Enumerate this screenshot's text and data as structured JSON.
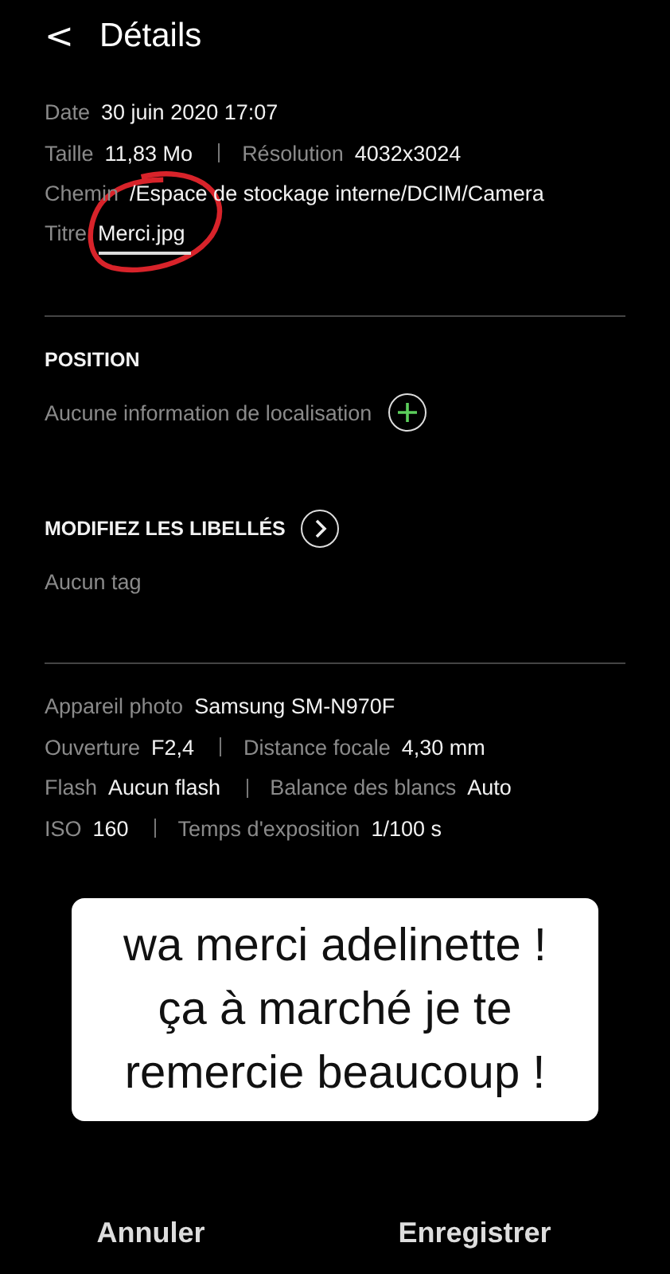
{
  "header": {
    "back": "<",
    "title": "Détails"
  },
  "file_info": [
    [
      {
        "label": "Date",
        "value": "30 juin 2020 17:07"
      }
    ],
    [
      {
        "label": "Taille",
        "value": "11,83 Mo"
      },
      {
        "label": "Résolution",
        "value": "4032x3024"
      }
    ],
    [
      {
        "label": "Chemin",
        "value": "/Espace de stockage interne/DCIM/Camera"
      }
    ]
  ],
  "title_field": {
    "label": "Titre",
    "value": "Merci.jpg"
  },
  "position": {
    "heading": "POSITION",
    "text": "Aucune information de localisation"
  },
  "tags": {
    "heading": "MODIFIEZ LES LIBELLÉS",
    "text": "Aucun tag"
  },
  "camera_info": [
    [
      {
        "label": "Appareil photo",
        "value": "Samsung SM-N970F"
      }
    ],
    [
      {
        "label": "Ouverture",
        "value": "F2,4"
      },
      {
        "label": "Distance focale",
        "value": "4,30 mm"
      }
    ],
    [
      {
        "label": "Flash",
        "value": "Aucun flash"
      },
      {
        "label": "Balance des blancs",
        "value": "Auto"
      }
    ],
    [
      {
        "label": "ISO",
        "value": "160"
      },
      {
        "label": "Temps d'exposition",
        "value": "1/100 s"
      }
    ]
  ],
  "sticker": "wa merci adelinette ! ça à marché je te remercie beaucoup !",
  "buttons": [
    "Annuler",
    "Enregistrer"
  ]
}
